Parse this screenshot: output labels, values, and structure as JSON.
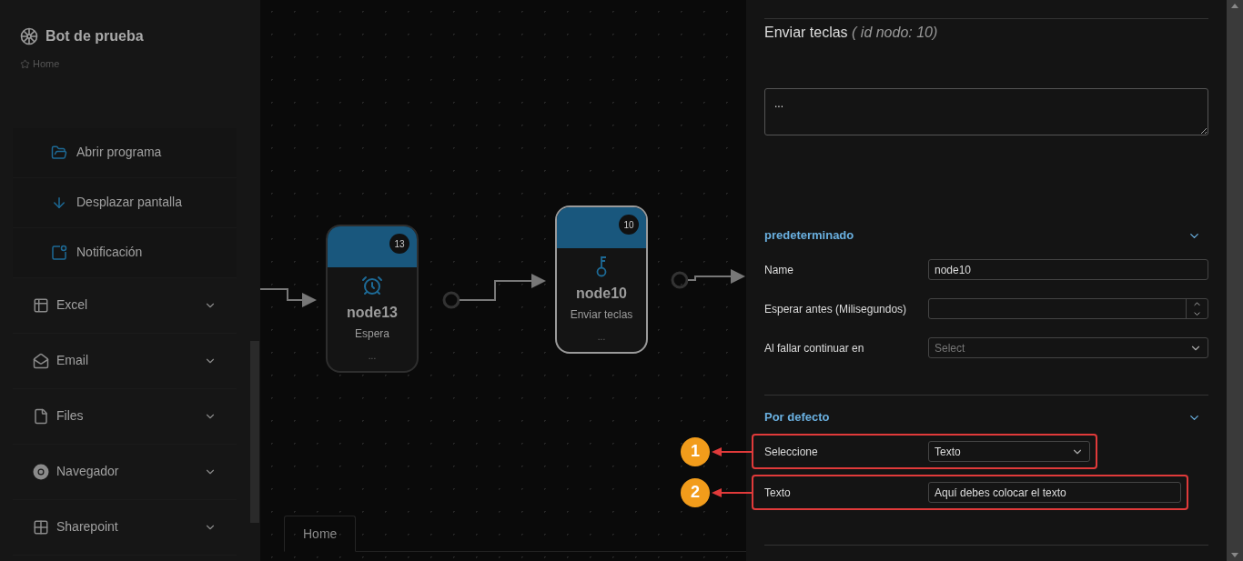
{
  "app": {
    "title": "Bot de prueba",
    "breadcrumb": "Home"
  },
  "sidebar": {
    "subitems": [
      {
        "label": "Abrir programa"
      },
      {
        "label": "Desplazar pantalla"
      },
      {
        "label": "Notificación"
      }
    ],
    "categories": [
      {
        "label": "Excel",
        "expanded": false
      },
      {
        "label": "Email",
        "expanded": false
      },
      {
        "label": "Files",
        "expanded": false
      },
      {
        "label": "Navegador",
        "expanded": false
      },
      {
        "label": "Sharepoint",
        "expanded": false
      }
    ]
  },
  "canvas": {
    "nodes": [
      {
        "title": "node13",
        "subtitle": "Espera",
        "badge": "13",
        "more": "...",
        "selected": false
      },
      {
        "title": "node10",
        "subtitle": "Enviar teclas",
        "badge": "10",
        "more": "...",
        "selected": true
      }
    ],
    "tabs": [
      {
        "label": "Home",
        "selected": true
      }
    ]
  },
  "panel": {
    "title": "Enviar teclas",
    "id_note": "( id nodo: 10)",
    "description": "...",
    "sections": [
      {
        "title": "predeterminado",
        "expanded": true,
        "fields": [
          {
            "label": "Name",
            "kind": "text",
            "value": "node10"
          },
          {
            "label": "Esperar antes (Milisegundos)",
            "kind": "number"
          },
          {
            "label": "Al fallar continuar en",
            "kind": "select",
            "placeholder": "Select"
          }
        ]
      },
      {
        "title": "Por defecto",
        "expanded": true,
        "fields": [
          {
            "label": "Seleccione",
            "kind": "select",
            "value": "Texto",
            "callout": "1"
          },
          {
            "label": "Texto",
            "kind": "text",
            "value": "Aquí debes colocar el texto",
            "callout": "2"
          }
        ]
      }
    ]
  }
}
